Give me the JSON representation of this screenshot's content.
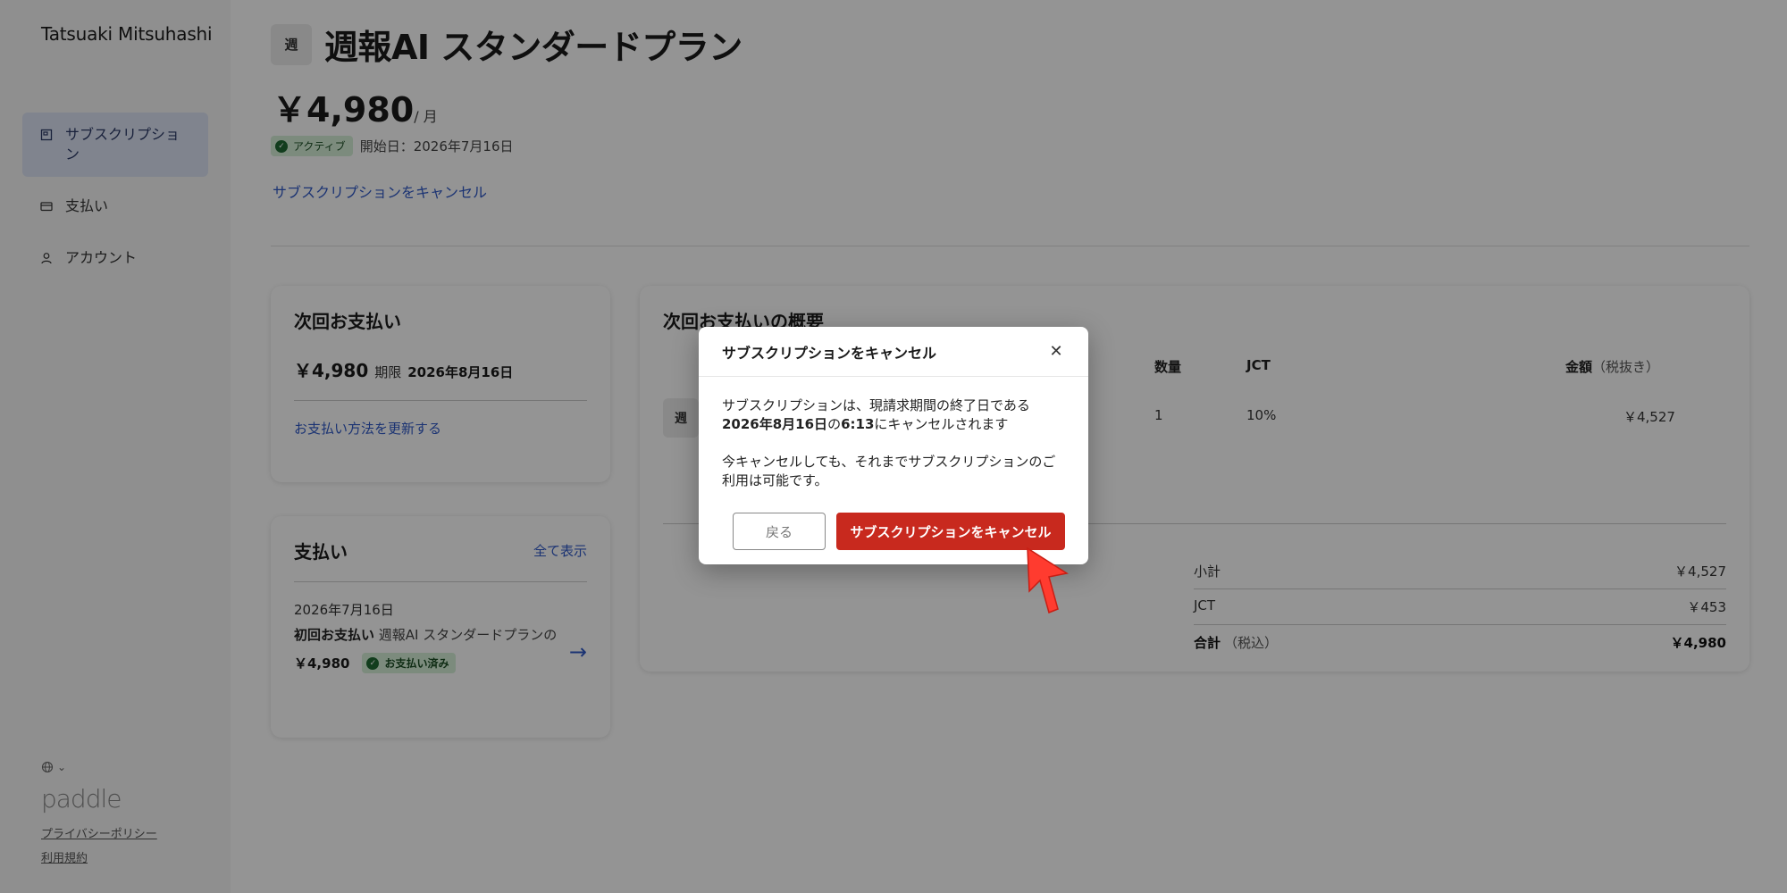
{
  "sidebar": {
    "user_name": "Tatsuaki Mitsuhashi",
    "items": [
      {
        "label": "サブスクリプション",
        "icon": "box-icon",
        "active": true
      },
      {
        "label": "支払い",
        "icon": "credit-card-icon",
        "active": false
      },
      {
        "label": "アカウント",
        "icon": "user-icon",
        "active": false
      }
    ],
    "language_icon": "globe-icon",
    "logo_text": "paddle",
    "privacy_link": "プライバシーポリシー",
    "terms_link": "利用規約"
  },
  "plan": {
    "badge": "週",
    "title": "週報AI スタンダードプラン",
    "price": "￥4,980",
    "period": "/ 月",
    "status": "アクティブ",
    "start_date": "開始日：2026年7月16日",
    "cancel_link": "サブスクリプションをキャンセル"
  },
  "next_payment": {
    "title": "次回お支払い",
    "amount": "￥4,980",
    "due_label": "期限",
    "due_date": "2026年8月16日",
    "update_link": "お支払い方法を更新する"
  },
  "payments": {
    "title": "支払い",
    "view_all": "全て表示",
    "items": [
      {
        "date": "2026年7月16日",
        "type": "初回お支払い",
        "desc": "週報AI スタンダードプランの",
        "amount": "￥4,980",
        "status": "お支払い済み"
      }
    ]
  },
  "summary": {
    "title": "次回お支払いの概要",
    "columns": {
      "qty": "数量",
      "tax": "JCT",
      "amount": "金額",
      "amount_note": "（税抜き）"
    },
    "row": {
      "badge": "週",
      "qty": "1",
      "tax": "10%",
      "amount": "￥4,527"
    },
    "totals": [
      {
        "label": "小計",
        "note": "",
        "value": "￥4,527"
      },
      {
        "label": "JCT",
        "note": "",
        "value": "￥453"
      },
      {
        "label": "合計",
        "note": "（税込）",
        "value": "￥4,980"
      }
    ]
  },
  "modal": {
    "title": "サブスクリプションをキャンセル",
    "line1_pre": "サブスクリプションは、現請求期間の終了日である",
    "line1_date": "2026年8月16日",
    "line1_mid": "の",
    "line1_time": "6:13",
    "line1_post": "にキャンセルされます",
    "line2": "今キャンセルしても、それまでサブスクリプションのご利用は可能です。",
    "back_button": "戻る",
    "confirm_button": "サブスクリプションをキャンセル"
  },
  "colors": {
    "accent_blue": "#2f59c7",
    "danger_red": "#c8291e",
    "success_green": "#1f6a32",
    "pointer_red": "#ff3b2f"
  }
}
